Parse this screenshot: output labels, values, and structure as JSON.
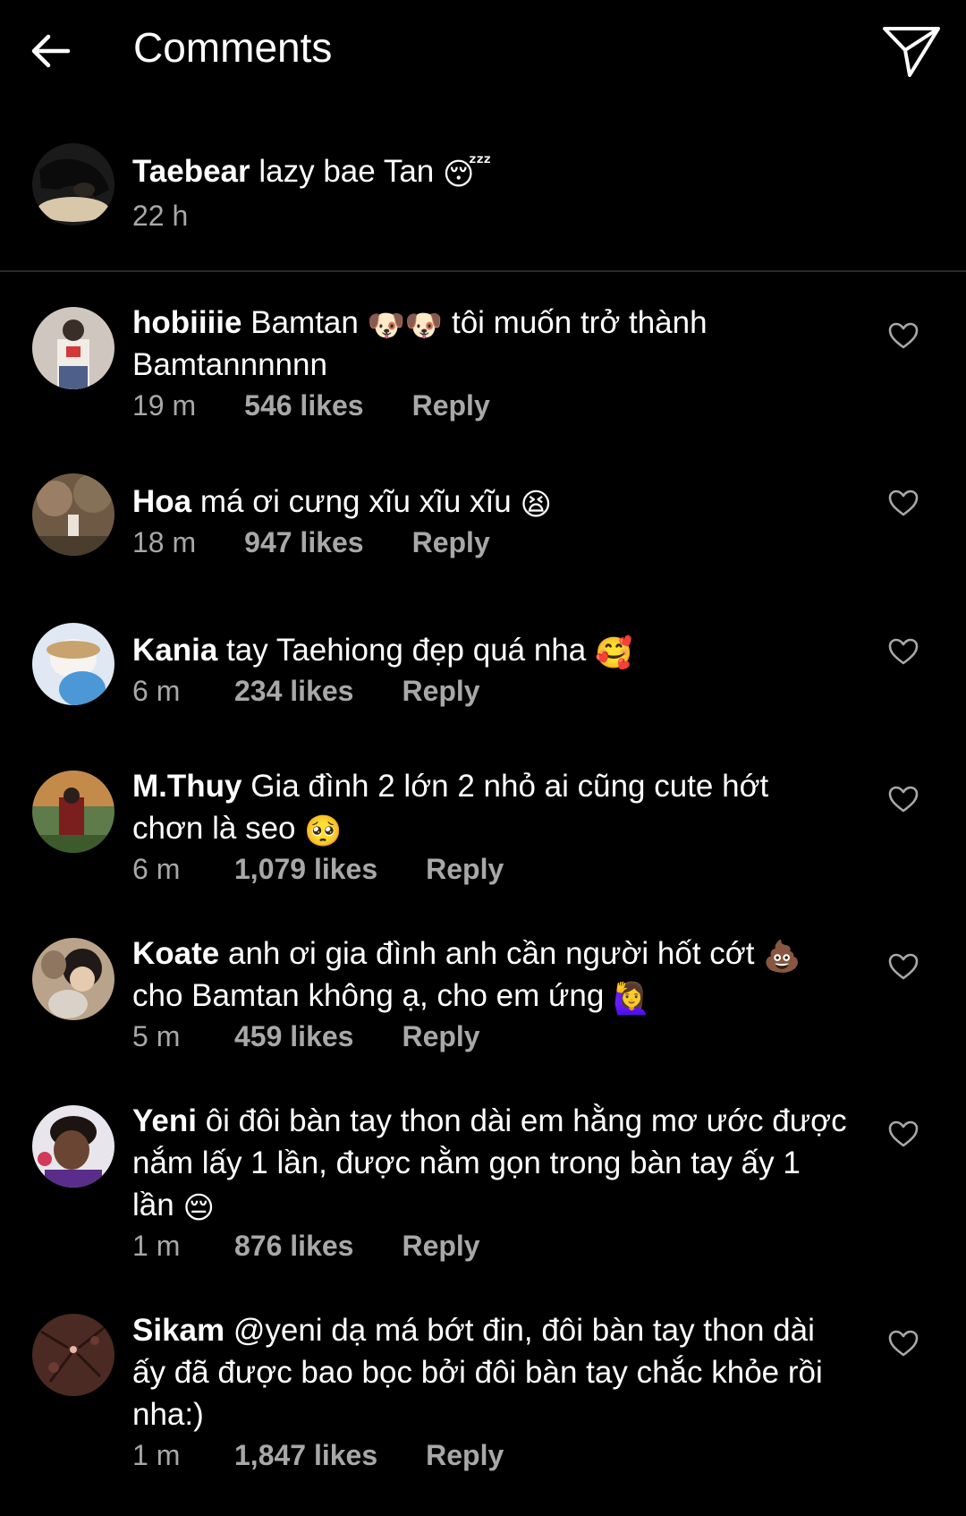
{
  "header": {
    "title": "Comments",
    "back_icon": "arrow-left-icon",
    "send_icon": "paper-plane-icon"
  },
  "caption": {
    "username": "Taebear",
    "text": " lazy bae Tan ",
    "emoji": "😴",
    "time": "22 h"
  },
  "comments": [
    {
      "username": "hobiiiie",
      "text_before": " Bamtan ",
      "emoji_mid": "🐶🐶",
      "text_after": " tôi muốn trở thành Bamtannnnnn",
      "emoji_end": "",
      "time": "19 m",
      "likes": "546 likes",
      "reply": "Reply"
    },
    {
      "username": "Hoa",
      "text_before": " má ơi cưng xĩu xĩu xĩu ",
      "emoji_mid": "😫",
      "text_after": "",
      "emoji_end": "",
      "time": "18 m",
      "likes": "947 likes",
      "reply": "Reply"
    },
    {
      "username": "Kania",
      "text_before": " tay Taehiong đẹp quá nha ",
      "emoji_mid": "🥰",
      "text_after": "",
      "emoji_end": "",
      "time": "6 m",
      "likes": "234 likes",
      "reply": "Reply"
    },
    {
      "username": "M.Thuy",
      "text_before": " Gia đình 2 lớn 2 nhỏ ai cũng cute hớt chơn là seo ",
      "emoji_mid": "🥺",
      "text_after": "",
      "emoji_end": "",
      "time": "6 m",
      "likes": "1,079 likes",
      "reply": "Reply"
    },
    {
      "username": "Koate",
      "text_before": " anh ơi gia đình anh cần người hốt cớt ",
      "emoji_mid": "💩",
      "text_after": " cho Bamtan không ạ, cho em ứng ",
      "emoji_end": "🙋‍♀️",
      "time": "5 m",
      "likes": "459 likes",
      "reply": "Reply"
    },
    {
      "username": "Yeni",
      "text_before": " ôi đôi bàn tay thon dài em hằng mơ ước được nắm lấy 1 lần, được nằm gọn trong bàn tay ấy 1 lần ",
      "emoji_mid": "😔",
      "text_after": "",
      "emoji_end": "",
      "time": "1 m",
      "likes": "876 likes",
      "reply": "Reply"
    },
    {
      "username": "Sikam",
      "text_before": " @yeni dạ má bớt đin, đôi bàn tay thon dài ấy đã được bao bọc bởi đôi bàn tay chắc khỏe rồi nha:)",
      "emoji_mid": "",
      "text_after": "",
      "emoji_end": "",
      "time": "1 m",
      "likes": "1,847 likes",
      "reply": "Reply"
    }
  ]
}
